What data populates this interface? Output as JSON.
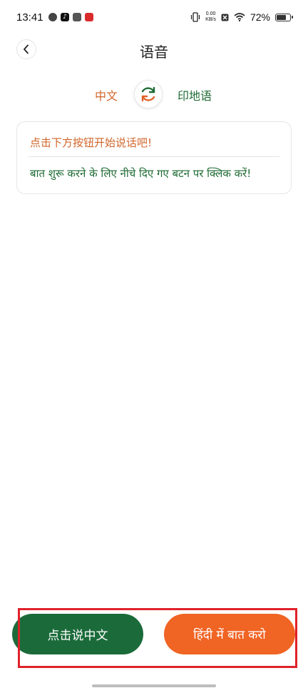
{
  "status_bar": {
    "time": "13:41",
    "net_speed_value": "0.00",
    "net_speed_unit": "KB/s",
    "battery_percent": "72%",
    "battery_level": 0.72
  },
  "header": {
    "title": "语音",
    "back_icon": "chevron-left-icon"
  },
  "language_switch": {
    "source": "中文",
    "target": "印地语",
    "swap_icon": "swap-arrows-icon"
  },
  "hint_card": {
    "chinese": "点击下方按钮开始说话吧!",
    "hindi": "बात शुरू करने के लिए नीचे दिए गए बटन पर क्लिक करें!"
  },
  "actions": {
    "speak_chinese_label": "点击说中文",
    "speak_hindi_label": "हिंदी में बात करो"
  },
  "colors": {
    "chinese_accent": "#d2662a",
    "hindi_accent": "#1f6b34",
    "chinese_button": "#1b6b3a",
    "hindi_button": "#f06424",
    "highlight": "#e0222b"
  }
}
